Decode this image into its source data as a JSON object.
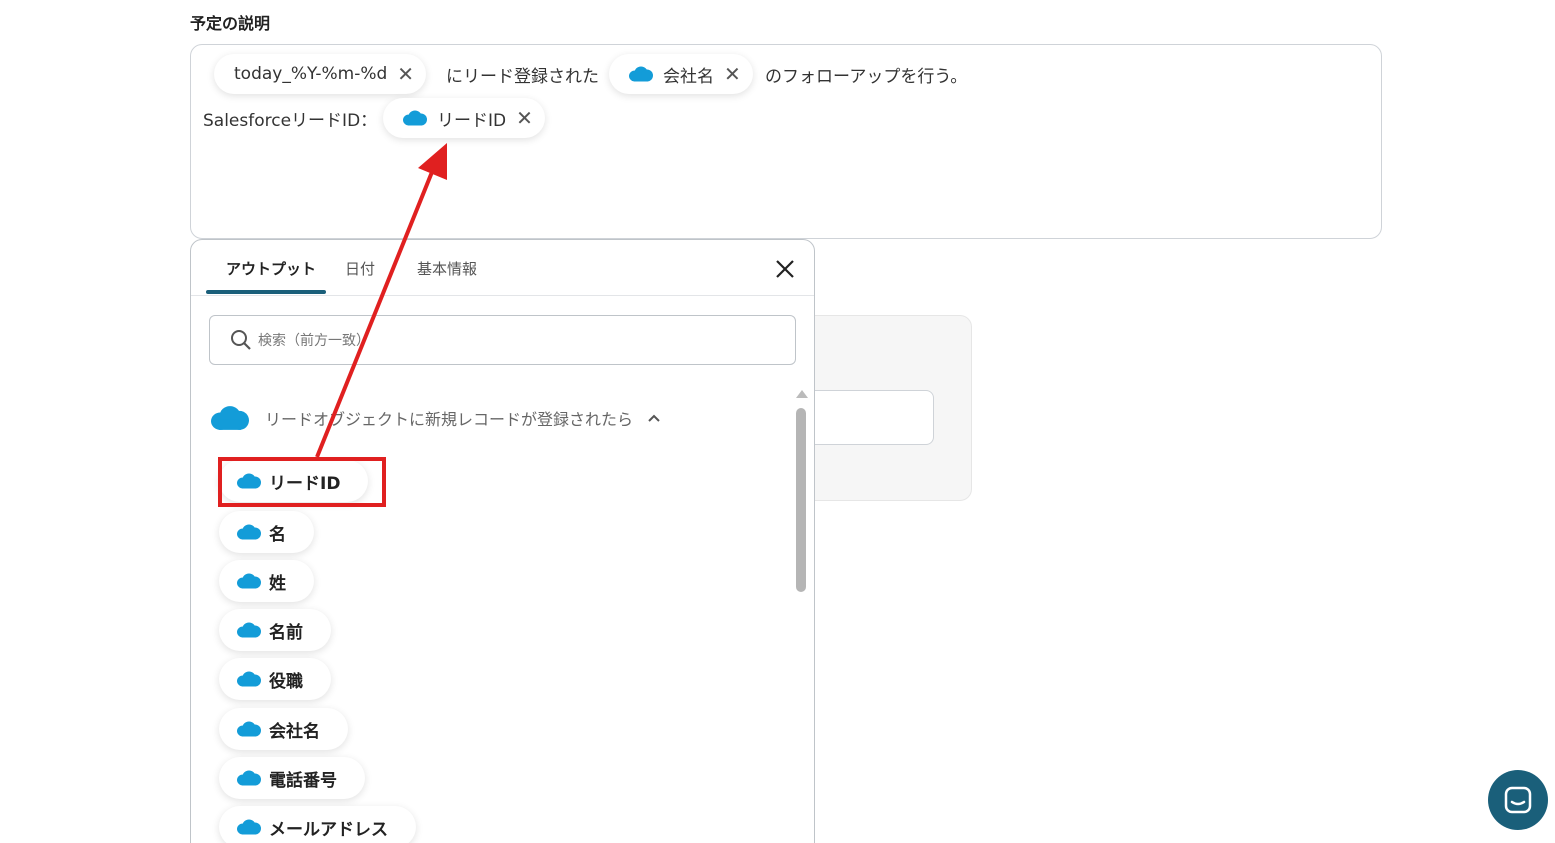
{
  "section": {
    "label": "予定の説明"
  },
  "description": {
    "chip_date": "today_%Y-%m-%d",
    "text_1": "にリード登録された",
    "chip_company": "会社名",
    "text_2": "のフォローアップを行う。",
    "text_3": "SalesforceリードID：",
    "chip_lead_id": "リードID",
    "remove_symbol": "✕"
  },
  "panel": {
    "tabs": [
      {
        "label": "アウトプット",
        "active": true
      },
      {
        "label": "日付",
        "active": false
      },
      {
        "label": "基本情報",
        "active": false
      }
    ],
    "search_placeholder": "検索（前方一致）",
    "group_title": "リードオブジェクトに新規レコードが登録されたら",
    "items": [
      "リードID",
      "名",
      "姓",
      "名前",
      "役職",
      "会社名",
      "電話番号",
      "メールアドレス"
    ],
    "close_icon": "close-icon"
  },
  "colors": {
    "salesforce": "#139CD8",
    "accent": "#1a5f7a",
    "annotation": "#e02020"
  }
}
